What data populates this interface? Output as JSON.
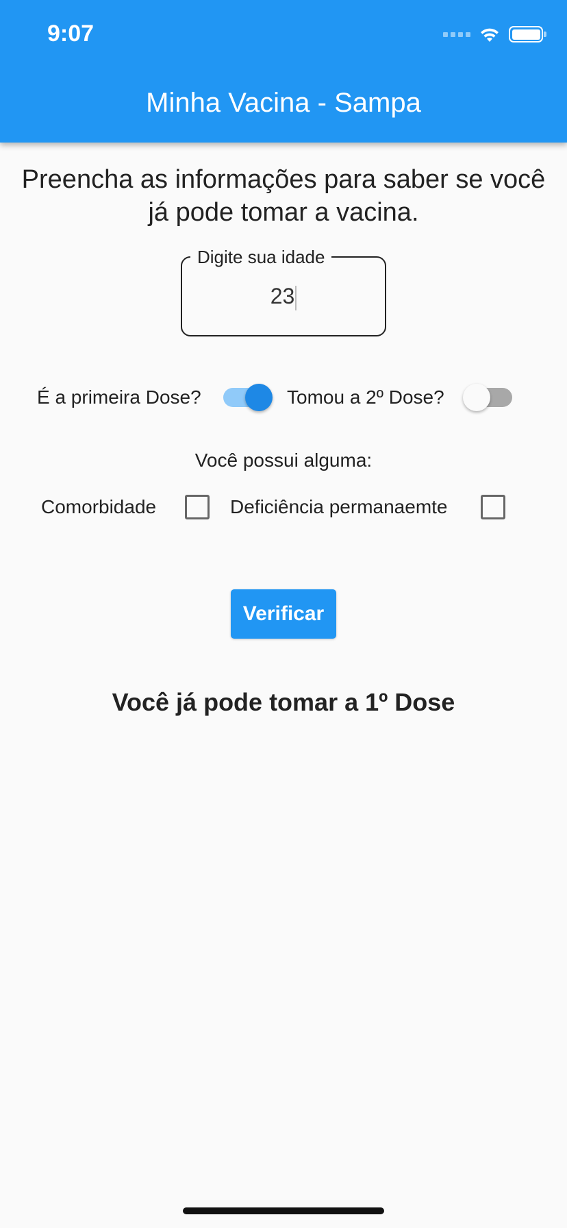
{
  "status_bar": {
    "time": "9:07",
    "icons": [
      "cellular-signal-icon",
      "wifi-icon",
      "battery-icon"
    ]
  },
  "app_bar": {
    "title": "Minha Vacina - Sampa",
    "color": "#2196f3"
  },
  "intro_text": "Preencha as informações para saber se você já pode tomar a vacina.",
  "age_field": {
    "label": "Digite sua idade",
    "value": "23"
  },
  "switches": [
    {
      "label": "É a primeira Dose?",
      "on": true
    },
    {
      "label": "Tomou a 2º Dose?",
      "on": false
    }
  ],
  "conditions": {
    "heading": "Você possui alguma:",
    "options": [
      {
        "label": "Comorbidade",
        "checked": false
      },
      {
        "label": "Deficiência permanaemte",
        "checked": false
      }
    ]
  },
  "verify_button": {
    "label": "Verificar"
  },
  "result_text": "Você já pode tomar a 1º Dose"
}
